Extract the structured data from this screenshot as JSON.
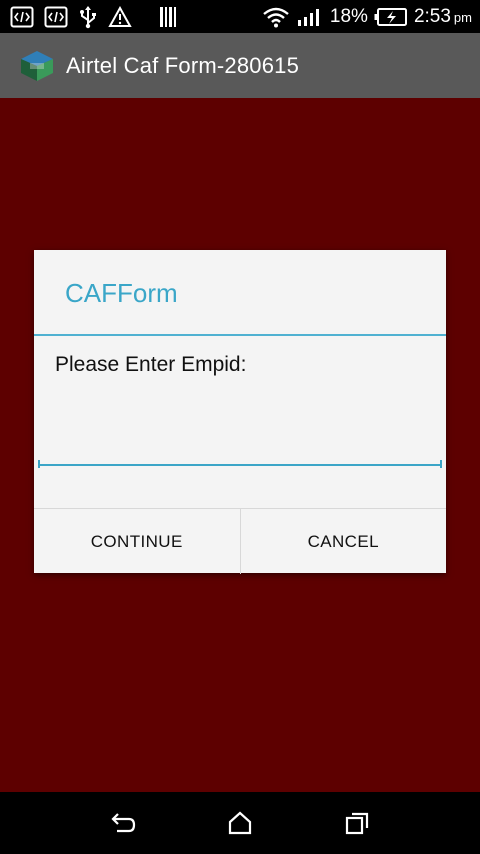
{
  "status_bar": {
    "icons": [
      "code-icon",
      "code-icon",
      "usb-icon",
      "warning-icon",
      "barcode-icon",
      "wifi-icon",
      "signal-icon",
      "battery-charging-icon"
    ],
    "battery_percent": "18%",
    "time": "2:53",
    "ampm": "pm"
  },
  "action_bar": {
    "app_icon": "app-logo-icon",
    "title": "Airtel Caf Form-280615"
  },
  "dialog": {
    "title": "CAFForm",
    "message": "Please Enter Empid:",
    "input_value": "",
    "continue_label": "CONTINUE",
    "cancel_label": "CANCEL"
  },
  "nav_bar": {
    "buttons": [
      "back-icon",
      "home-icon",
      "recents-icon"
    ]
  },
  "colors": {
    "background": "#5d0000",
    "action_bar": "#595959",
    "accent": "#3aa6c8",
    "dialog_bg": "#f4f4f4"
  }
}
